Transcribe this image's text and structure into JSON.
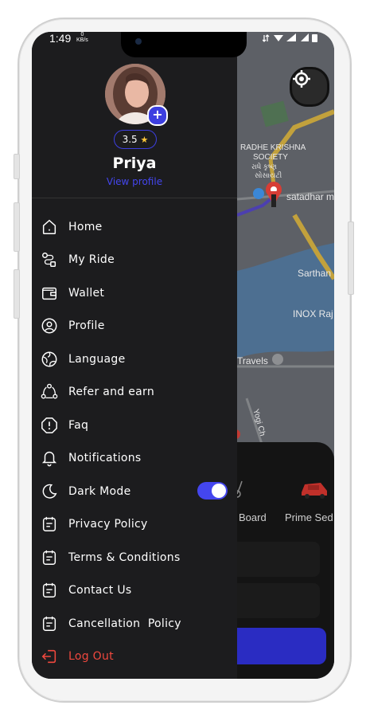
{
  "status_bar": {
    "time": "1:49",
    "data_speed": "0",
    "data_unit": "KB/s"
  },
  "map": {
    "labels": [
      "RADHE KRISHNA",
      "SOCIETY",
      "રાધે કૃષ્ણ",
      "સોસાયટી",
      "satadhar m",
      "Sarthan",
      "INOX Raj",
      "Travels",
      "Yogi Ch"
    ]
  },
  "ride_options": {
    "option_1": "Board",
    "option_2": "Prime Sed"
  },
  "profile": {
    "name": "Priya",
    "rating": "3.5",
    "view_profile_label": "View profile"
  },
  "menu": {
    "items": [
      {
        "label": "Home",
        "icon": "home-icon"
      },
      {
        "label": "My Ride",
        "icon": "route-icon"
      },
      {
        "label": "Wallet",
        "icon": "wallet-icon"
      },
      {
        "label": "Profile",
        "icon": "profile-icon"
      },
      {
        "label": "Language",
        "icon": "globe-icon"
      },
      {
        "label": "Refer and earn",
        "icon": "share-icon"
      },
      {
        "label": "Faq",
        "icon": "faq-icon"
      },
      {
        "label": "Notifications",
        "icon": "bell-icon"
      },
      {
        "label": "Dark Mode",
        "icon": "moon-icon"
      },
      {
        "label": "Privacy Policy",
        "icon": "document-icon"
      },
      {
        "label": "Terms & Conditions",
        "icon": "document-icon"
      },
      {
        "label": "Contact Us",
        "icon": "document-icon"
      },
      {
        "label": "Cancellation  Policy",
        "icon": "document-icon"
      },
      {
        "label": "Log Out",
        "icon": "logout-icon"
      }
    ],
    "dark_mode_enabled": true
  },
  "colors": {
    "accent": "#4446ee",
    "drawer_bg": "#1c1c1e",
    "logout": "#f0483e",
    "star": "#ffc83a"
  }
}
